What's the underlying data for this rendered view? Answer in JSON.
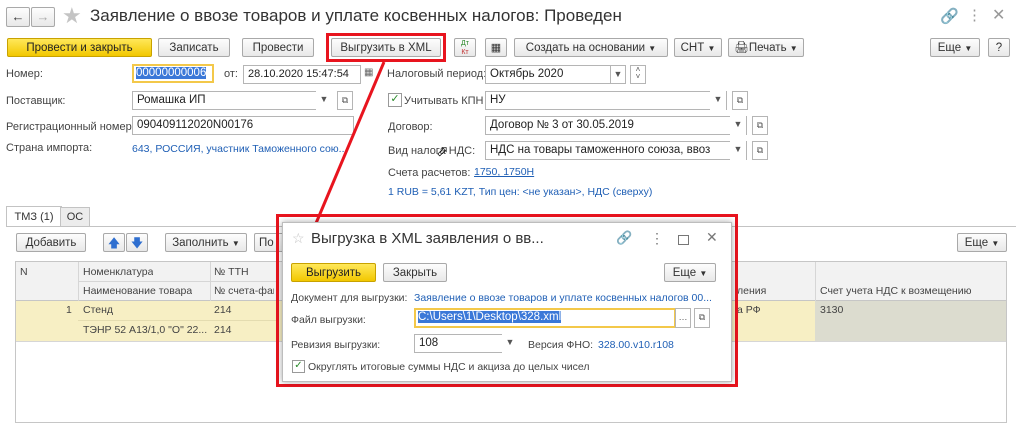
{
  "window": {
    "title": "Заявление о ввозе товаров и уплате косвенных налогов: Проведен"
  },
  "toolbar": {
    "post_close": "Провести и закрыть",
    "save": "Записать",
    "post": "Провести",
    "export_xml": "Выгрузить в XML",
    "create_based": "Создать на основании",
    "snt": "СНТ",
    "print": "Печать",
    "more": "Еще",
    "help": "?"
  },
  "form": {
    "number_label": "Номер:",
    "number_value": "00000000006",
    "date_from_label": "от:",
    "date_value": "28.10.2020 15:47:54",
    "tax_period_label": "Налоговый период:",
    "tax_period_value": "Октябрь 2020",
    "supplier_label": "Поставщик:",
    "supplier_value": "Ромашка ИП",
    "consider_kpn_label": "Учитывать КПН",
    "kpn_value": "НУ",
    "reg_number_label": "Регистрационный номер:",
    "reg_number_value": "090409112020N00176",
    "contract_label": "Договор:",
    "contract_value": "Договор № 3 от 30.05.2019",
    "import_country_label": "Страна импорта:",
    "import_country_value": "643, РОССИЯ, участник Таможенного сою...",
    "vat_type_label": "Вид налога НДС:",
    "vat_type_value": "НДС на товары таможенного союза, ввоз",
    "accounts_label": "Счета расчетов:",
    "accounts_value": "1750, 1750Н",
    "currency_info": "1 RUB = 5,61 KZT, Тип цен: <не указан>, НДС (сверху)"
  },
  "tabs": [
    {
      "label": "ТМЗ (1)"
    },
    {
      "label": "ОС"
    }
  ],
  "table_toolbar": {
    "add": "Добавить",
    "fill": "Заполнить",
    "more": "Еще",
    "partial": "По"
  },
  "table": {
    "header_row1": [
      "N",
      "Номенклатура",
      "№ ТТН",
      "ления",
      "Счет учета НДС к возмещению"
    ],
    "header_row2": [
      "",
      "Наименование товара",
      "№ счета-фак"
    ],
    "row": {
      "n": "1",
      "item": "Стенд",
      "item_name": "ТЭНР 52 А13/1,0 \"О\" 22...",
      "ttn": "214",
      "invoice": "214",
      "country_part": "а РФ",
      "vat_account": "3130"
    }
  },
  "dialog": {
    "title": "Выгрузка в XML заявления о вв...",
    "export_button": "Выгрузить",
    "close_button": "Закрыть",
    "more": "Еще",
    "doc_label": "Документ для выгрузки:",
    "doc_value": "Заявление о ввозе товаров и уплате косвенных налогов 00...",
    "file_label": "Файл выгрузки:",
    "file_value": "C:\\Users\\1\\Desktop\\328.xml",
    "revision_label": "Ревизия выгрузки:",
    "revision_value": "108",
    "fno_label": "Версия ФНО:",
    "fno_value": "328.00.v10.r108",
    "round_label": "Округлять итоговые суммы НДС и акциза до целых чисел"
  },
  "colors": {
    "accent_yellow": "#f2c700",
    "highlight_red": "#e8141e",
    "link_blue": "#1f5fb5",
    "row_selected": "#f7efc4"
  }
}
